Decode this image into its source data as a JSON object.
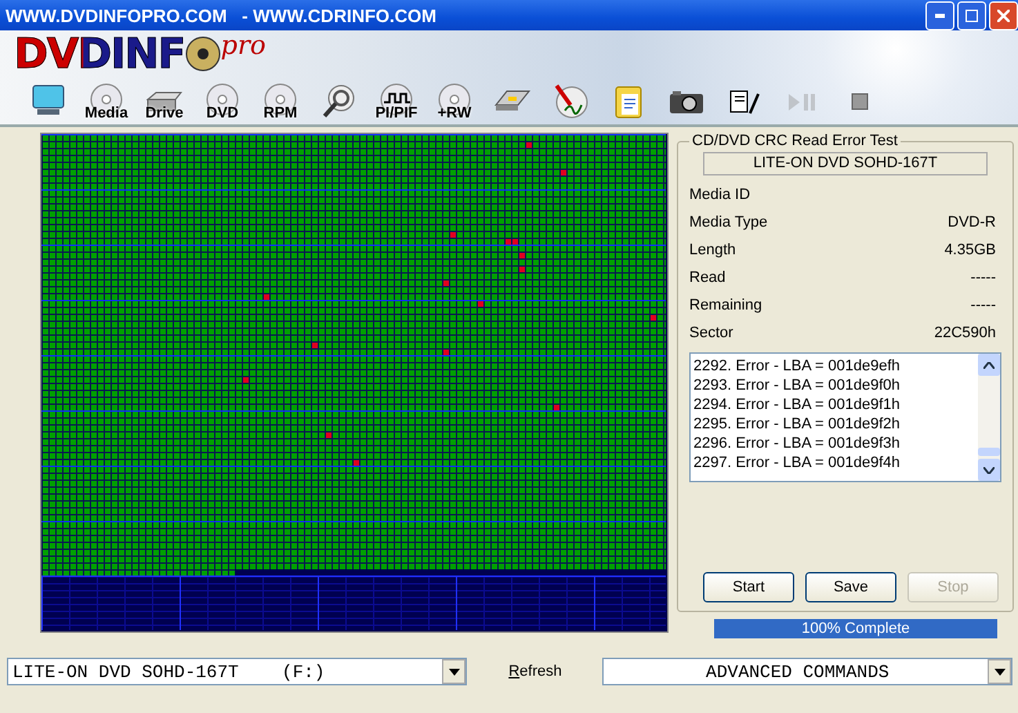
{
  "window": {
    "title": "WWW.DVDINFOPRO.COM   - WWW.CDRINFO.COM"
  },
  "logo": {
    "text": "DVDINF",
    "suffix": "pro"
  },
  "toolbar": [
    {
      "kind": "monitor"
    },
    {
      "kind": "disc",
      "label": "Media"
    },
    {
      "kind": "drive",
      "label": "Drive"
    },
    {
      "kind": "disc",
      "label": "DVD"
    },
    {
      "kind": "disc",
      "label": "RPM"
    },
    {
      "kind": "magnifier"
    },
    {
      "kind": "wave",
      "label": "PI/PIF"
    },
    {
      "kind": "disc",
      "label": "+RW"
    },
    {
      "kind": "scanner"
    },
    {
      "kind": "pen-disc"
    },
    {
      "kind": "clipboard"
    },
    {
      "kind": "camera"
    },
    {
      "kind": "notes"
    },
    {
      "kind": "play-pause",
      "disabled": true
    },
    {
      "kind": "stop",
      "disabled": false
    }
  ],
  "test_panel": {
    "title": "CD/DVD CRC Read Error Test",
    "drive": "LITE-ON DVD SOHD-167T",
    "info": [
      {
        "label": "Media ID"
      },
      {
        "label": "Media Type",
        "value": "DVD-R"
      },
      {
        "label": "Length",
        "value": "4.35GB"
      },
      {
        "label": "Read",
        "value": "-----"
      },
      {
        "label": "Remaining",
        "value": "-----"
      },
      {
        "label": "Sector",
        "value": "22C590h"
      }
    ],
    "log": [
      "2292. Error - LBA = 001de9efh",
      "2293. Error - LBA = 001de9f0h",
      "2294. Error - LBA = 001de9f1h",
      "2295. Error - LBA = 001de9f2h",
      "2296. Error - LBA = 001de9f3h",
      "2297. Error - LBA = 001de9f4h"
    ],
    "buttons": [
      {
        "label": "Start",
        "disabled": false
      },
      {
        "label": "Save",
        "disabled": false
      },
      {
        "label": "Stop",
        "disabled": true
      }
    ]
  },
  "progress": {
    "label": "100% Complete",
    "level": 1
  },
  "drive_select": {
    "value": "LITE-ON DVD SOHD-167T    (F:)"
  },
  "refresh": {
    "label": "Refresh"
  },
  "commands_select": {
    "value": "ADVANCED COMMANDS"
  }
}
